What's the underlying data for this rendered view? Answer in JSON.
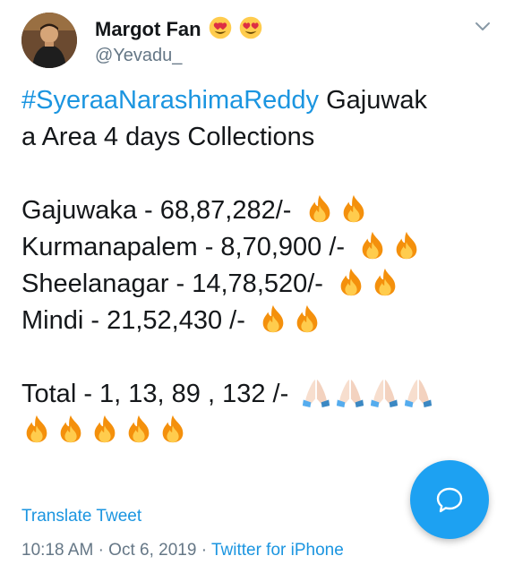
{
  "tweet": {
    "author": {
      "display_name": "Margot Fan",
      "name_emojis": [
        "heart-eyes",
        "heart-eyes"
      ],
      "handle": "@Yevadu_"
    },
    "lines": [
      {
        "type": "text",
        "hashtag": "#SyeraaNarashimaReddy",
        "text": " Gajuwak"
      },
      {
        "type": "text",
        "text": "a Area 4 days Collections"
      },
      {
        "type": "blank"
      },
      {
        "type": "text",
        "text": "Gajuwaka - 68,87,282/- ",
        "emojis": [
          "fire",
          "fire"
        ]
      },
      {
        "type": "text",
        "text": "Kurmanapalem - 8,70,900 /- ",
        "emojis": [
          "fire",
          "fire"
        ]
      },
      {
        "type": "text",
        "text": "Sheelanagar - 14,78,520/- ",
        "emojis": [
          "fire",
          "fire"
        ]
      },
      {
        "type": "text",
        "text": "Mindi - 21,52,430 /- ",
        "emojis": [
          "fire",
          "fire"
        ]
      },
      {
        "type": "blank"
      },
      {
        "type": "text",
        "text": "Total - 1, 13, 89 , 132 /- ",
        "emojis": [
          "folded-hands",
          "folded-hands",
          "folded-hands",
          "folded-hands"
        ]
      },
      {
        "type": "emoji-only",
        "emojis": [
          "fire",
          "fire",
          "fire",
          "fire",
          "fire"
        ]
      }
    ],
    "translate_label": "Translate Tweet",
    "time": "10:18 AM",
    "separator": "·",
    "date": "Oct 6, 2019",
    "source": "Twitter for iPhone"
  },
  "colors": {
    "link": "#1b95e0",
    "secondary": "#657786",
    "fab": "#1da1f2"
  }
}
